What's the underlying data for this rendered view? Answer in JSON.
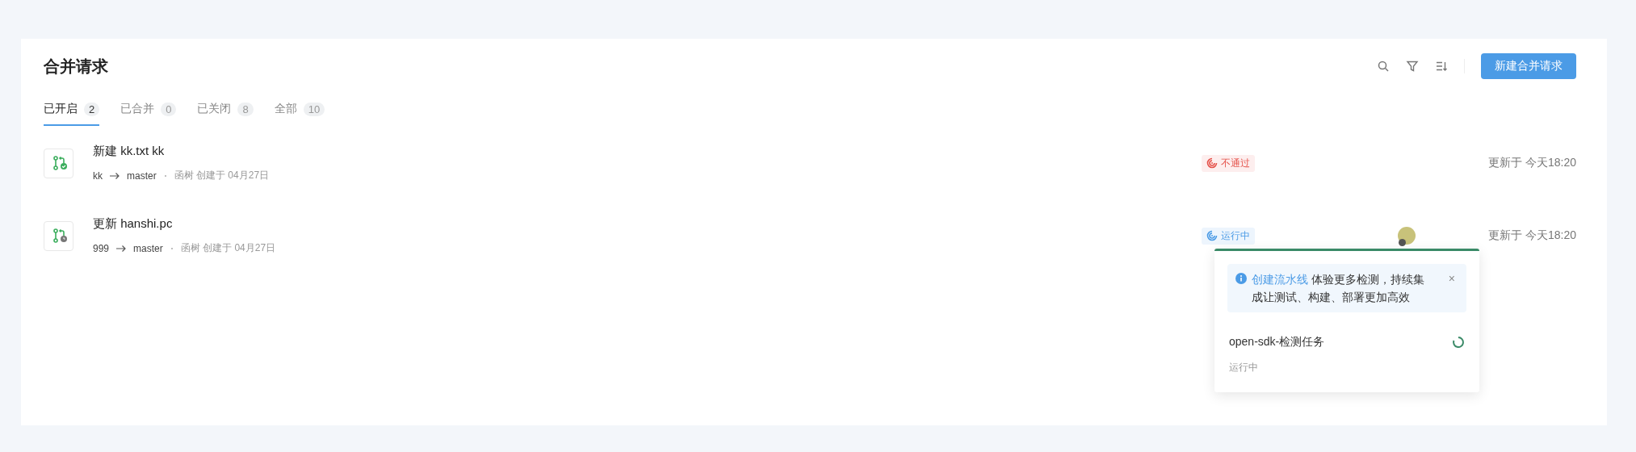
{
  "title": "合并请求",
  "new_button": "新建合并请求",
  "tabs": [
    {
      "label": "已开启",
      "count": "2",
      "selected": true
    },
    {
      "label": "已合并",
      "count": "0",
      "selected": false
    },
    {
      "label": "已关闭",
      "count": "8",
      "selected": false
    },
    {
      "label": "全部",
      "count": "10",
      "selected": false
    }
  ],
  "requests": [
    {
      "kind": "checked",
      "title": "新建 kk.txt kk",
      "source": "kk",
      "target": "master",
      "meta": "函树 创建于 04月27日",
      "status": {
        "kind": "failed",
        "label": "不通过"
      },
      "avatar": false,
      "updated": "更新于 今天18:20"
    },
    {
      "kind": "pending",
      "title": "更新 hanshi.pc",
      "source": "999",
      "target": "master",
      "meta": "函树 创建于 04月27日",
      "status": {
        "kind": "running",
        "label": "运行中"
      },
      "avatar": true,
      "updated": "更新于 今天18:20"
    }
  ],
  "popover": {
    "notice": {
      "link": "创建流水线",
      "text": "体验更多检测，持续集成让测试、构建、部署更加高效",
      "close": "×"
    },
    "task": {
      "name": "open-sdk-检测任务",
      "status": "运行中",
      "kind": "running"
    }
  }
}
